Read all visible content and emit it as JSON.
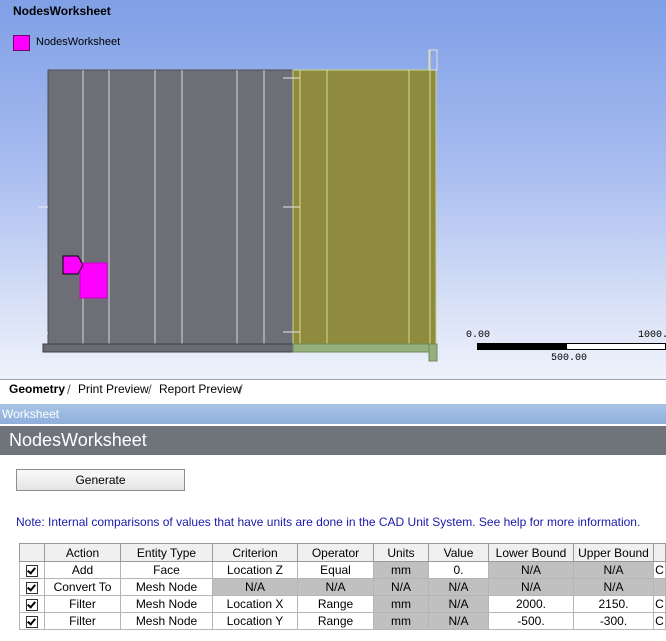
{
  "viewport": {
    "title": "NodesWorksheet",
    "legend": {
      "label": "NodesWorksheet",
      "color": "#ff00ff"
    },
    "scale": {
      "min": "0.00",
      "mid": "500.00",
      "max": "1000."
    }
  },
  "tabs": [
    {
      "label": "Geometry",
      "active": true
    },
    {
      "label": "Print Preview",
      "active": false
    },
    {
      "label": "Report Preview",
      "active": false
    }
  ],
  "worksheet": {
    "panel_title": "Worksheet",
    "header": "NodesWorksheet",
    "generate_label": "Generate",
    "note": "Note: Internal comparisons of values that have units are done in the CAD Unit System. See help for more information."
  },
  "table": {
    "columns": [
      "",
      "Action",
      "Entity Type",
      "Criterion",
      "Operator",
      "Units",
      "Value",
      "Lower Bound",
      "Upper Bound",
      ""
    ],
    "rows": [
      {
        "checked": true,
        "action": "Add",
        "entity": "Face",
        "criterion": "Location Z",
        "operator": "Equal",
        "units": "mm",
        "value": "0.",
        "lower": "N/A",
        "upper": "N/A",
        "extra": "C"
      },
      {
        "checked": true,
        "action": "Convert To",
        "entity": "Mesh Node",
        "criterion": "N/A",
        "operator": "N/A",
        "units": "N/A",
        "value": "N/A",
        "lower": "N/A",
        "upper": "N/A",
        "extra": ""
      },
      {
        "checked": true,
        "action": "Filter",
        "entity": "Mesh Node",
        "criterion": "Location X",
        "operator": "Range",
        "units": "mm",
        "value": "N/A",
        "lower": "2000.",
        "upper": "2150.",
        "extra": "C"
      },
      {
        "checked": true,
        "action": "Filter",
        "entity": "Mesh Node",
        "criterion": "Location Y",
        "operator": "Range",
        "units": "mm",
        "value": "N/A",
        "lower": "-500.",
        "upper": "-300.",
        "extra": "C"
      }
    ]
  }
}
